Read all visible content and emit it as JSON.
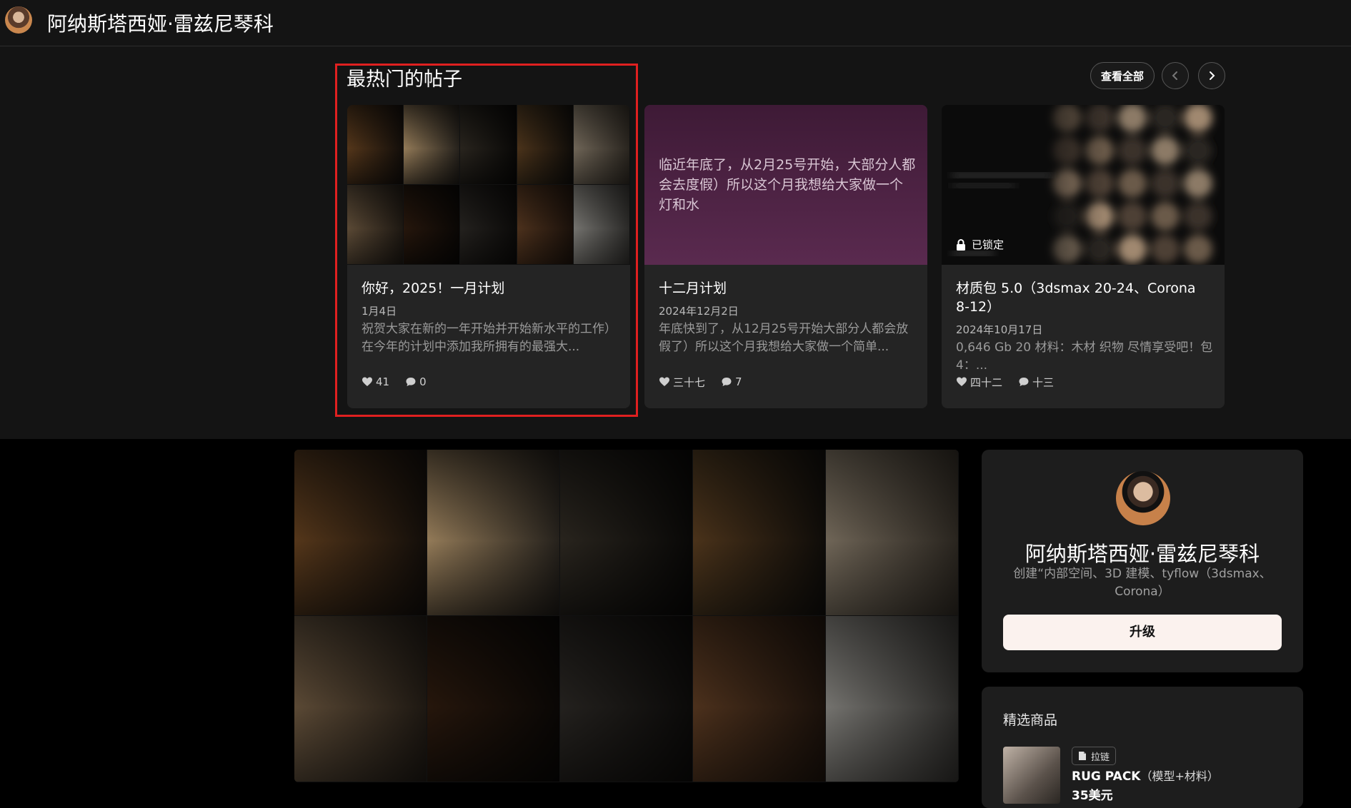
{
  "header": {
    "creator_name": "阿纳斯塔西娅·雷兹尼琴科"
  },
  "popular": {
    "section_title": "最热门的帖子",
    "view_all_label": "查看全部",
    "prev_icon": "chevron-left-icon",
    "next_icon": "chevron-right-icon",
    "posts": [
      {
        "title": "你好，2025！一月计划",
        "date": "1月4日",
        "excerpt": "祝贺大家在新的一年开始并开始新水平的工作）在今年的计划中添加我所拥有的最强大...",
        "likes": "41",
        "comments": "0"
      },
      {
        "thumb_text": "临近年底了，从2月25号开始，大部分人都会去度假）所以这个月我想给大家做一个灯和水",
        "title": "十二月计划",
        "date": "2024年12月2日",
        "excerpt": "年底快到了，从12月25号开始大部分人都会放假了）所以这个月我想给大家做一个简单...",
        "likes": "三十七",
        "comments": "7"
      },
      {
        "locked_label": "已锁定",
        "title": "材质包 5.0（3dsmax 20-24、Corona 8-12）",
        "date": "2024年10月17日",
        "excerpt": "0,646 Gb 20 材料：木材 织物 尽情享受吧！包 4：...",
        "likes": "四十二",
        "comments": "十三"
      }
    ]
  },
  "profile": {
    "name": "阿纳斯塔西娅·雷兹尼琴科",
    "description": "创建“内部空间、3D 建模、tyflow（3dsmax、Corona）",
    "upgrade_label": "升级"
  },
  "featured": {
    "title": "精选商品",
    "product": {
      "tag": "拉链",
      "name": "RUG PACK",
      "name_suffix": "（模型+材料）",
      "price": "35美元"
    }
  },
  "colors": {
    "highlight": "#e02020",
    "card_bg": "#242424",
    "page_bg": "#000000",
    "upgrade_bg": "#fbf2ee"
  }
}
